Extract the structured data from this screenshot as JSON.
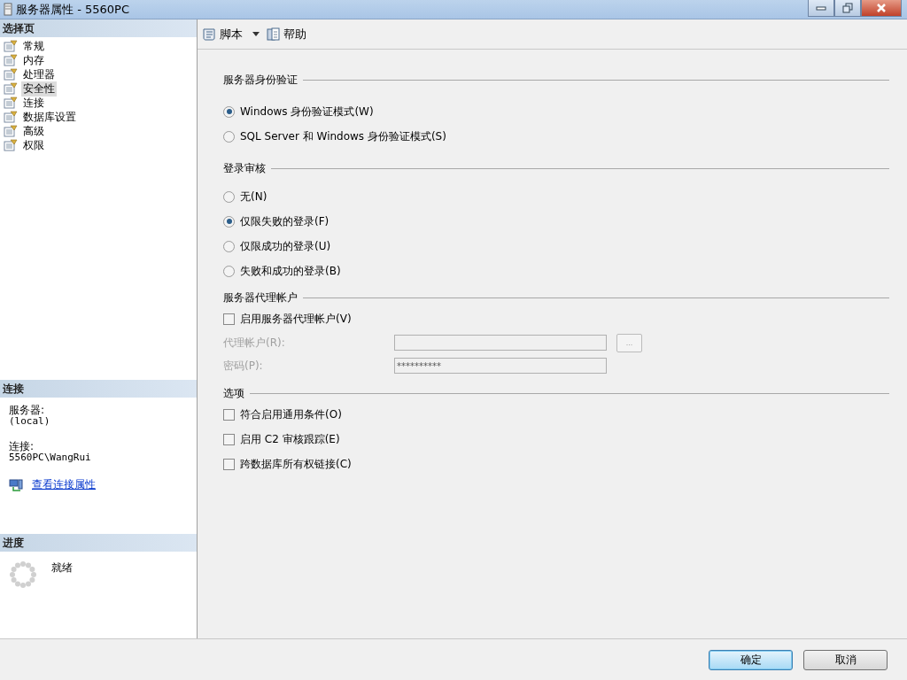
{
  "window": {
    "title": "服务器属性 - 5560PC"
  },
  "sidebar": {
    "header": "选择页",
    "items": [
      {
        "label": "常规",
        "selected": false
      },
      {
        "label": "内存",
        "selected": false
      },
      {
        "label": "处理器",
        "selected": false
      },
      {
        "label": "安全性",
        "selected": true
      },
      {
        "label": "连接",
        "selected": false
      },
      {
        "label": "数据库设置",
        "selected": false
      },
      {
        "label": "高级",
        "selected": false
      },
      {
        "label": "权限",
        "selected": false
      }
    ]
  },
  "connection": {
    "header": "连接",
    "server_label": "服务器:",
    "server": "(local)",
    "connection_label": "连接:",
    "connection": "5560PC\\WangRui",
    "link": "查看连接属性"
  },
  "progress": {
    "header": "进度",
    "status": "就绪"
  },
  "toolbar": [
    {
      "label": "脚本",
      "kind": "script"
    },
    {
      "label": "帮助",
      "kind": "help"
    }
  ],
  "server_auth": {
    "title": "服务器身份验证",
    "options": [
      {
        "label": "Windows 身份验证模式(W)",
        "selected": true
      },
      {
        "label": "SQL Server 和 Windows 身份验证模式(S)",
        "selected": false
      }
    ]
  },
  "login_audit": {
    "title": "登录审核",
    "options": [
      {
        "label": "无(N)",
        "selected": false
      },
      {
        "label": "仅限失败的登录(F)",
        "selected": true
      },
      {
        "label": "仅限成功的登录(U)",
        "selected": false
      },
      {
        "label": "失败和成功的登录(B)",
        "selected": false
      }
    ]
  },
  "proxy": {
    "title": "服务器代理帐户",
    "checkbox": {
      "label": "启用服务器代理帐户(V)",
      "checked": false
    },
    "fields": [
      {
        "label": "代理帐户(R):",
        "disabled": true
      },
      {
        "label": "密码(P):",
        "value": "**********",
        "disabled": true
      }
    ],
    "browse_button": {
      "label": "...",
      "disabled": true
    }
  },
  "options": {
    "title": "选项",
    "items": [
      {
        "label": "符合启用通用条件(O)",
        "checked": false
      },
      {
        "label": "启用 C2 审核跟踪(E)",
        "checked": false
      },
      {
        "label": "跨数据库所有权链接(C)",
        "checked": false
      }
    ]
  },
  "buttons": [
    {
      "label": "确定",
      "default": true
    },
    {
      "label": "取消",
      "default": false
    }
  ]
}
